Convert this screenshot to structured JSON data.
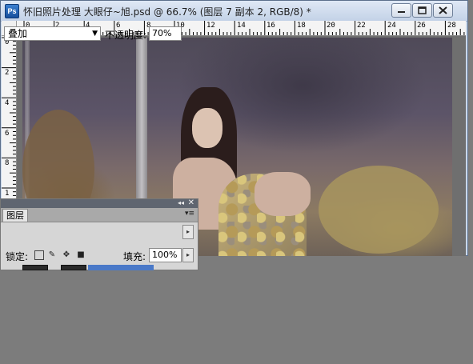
{
  "window": {
    "title": "怀旧照片处理 大眼仔~旭.psd @ 66.7% (图层 7 副本 2, RGB/8) *",
    "app_icon_label": "Ps"
  },
  "rulers": {
    "horizontal": [
      "0",
      "2",
      "4",
      "6",
      "8",
      "10",
      "12",
      "14",
      "16",
      "18",
      "20",
      "22",
      "24",
      "26",
      "28"
    ],
    "vertical": [
      "0",
      "2",
      "4",
      "6",
      "8",
      "1"
    ]
  },
  "layers_panel": {
    "tab_label": "图层",
    "blend_mode": "叠加",
    "opacity_label": "不透明度:",
    "opacity_value": "70%",
    "lock_label": "锁定:",
    "fill_label": "填充:",
    "fill_value": "100%"
  },
  "icons": {
    "app": "photoshop-icon",
    "minimize": "minimize-icon",
    "maximize": "maximize-icon",
    "close": "close-icon"
  }
}
